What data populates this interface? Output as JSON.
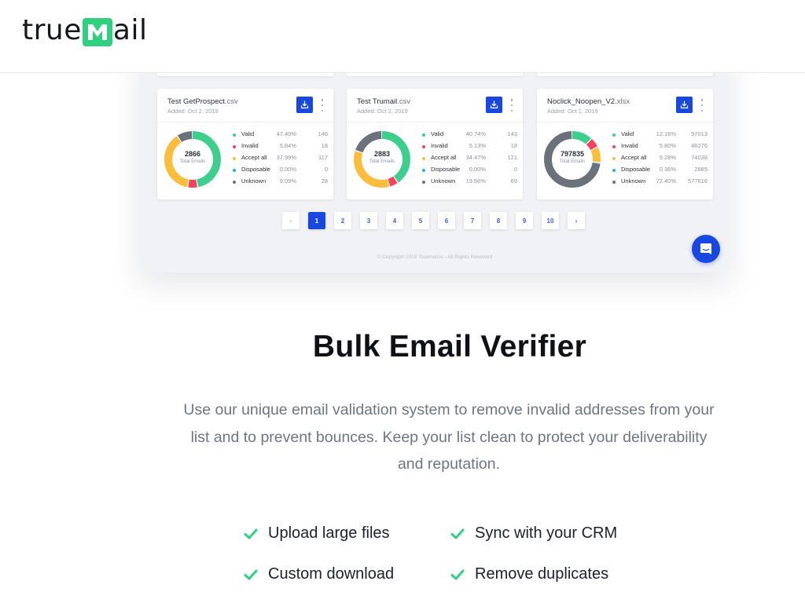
{
  "header": {
    "logo_text_before": "true",
    "logo_text_after": "ail",
    "logo_icon": "envelope-m-icon",
    "brand_color": "#2fd07f"
  },
  "screenshot": {
    "cards": [
      {
        "title_name": "Test GetProspect",
        "title_ext": ".csv",
        "added": "Added: Oct 2, 2019",
        "total": "2866",
        "total_label": "Total Emails",
        "rows": [
          {
            "label": "Valid",
            "pct": "47.40%",
            "count": "146"
          },
          {
            "label": "Invalid",
            "pct": "5.84%",
            "count": "18"
          },
          {
            "label": "Accept all",
            "pct": "37.99%",
            "count": "117"
          },
          {
            "label": "Disposable",
            "pct": "0.00%",
            "count": "0"
          },
          {
            "label": "Unknown",
            "pct": "9.09%",
            "count": "28"
          }
        ],
        "shares": [
          47.4,
          5.84,
          37.99,
          0.0,
          9.09
        ]
      },
      {
        "title_name": "Test Trumail",
        "title_ext": ".csv",
        "added": "Added: Oct 2, 2019",
        "total": "2883",
        "total_label": "Total Emails",
        "rows": [
          {
            "label": "Valid",
            "pct": "40.74%",
            "count": "143"
          },
          {
            "label": "Invalid",
            "pct": "5.13%",
            "count": "18"
          },
          {
            "label": "Accept all",
            "pct": "34.47%",
            "count": "121"
          },
          {
            "label": "Disposable",
            "pct": "0.00%",
            "count": "0"
          },
          {
            "label": "Unknown",
            "pct": "19.66%",
            "count": "69"
          }
        ],
        "shares": [
          40.74,
          5.13,
          34.47,
          0.0,
          19.66
        ]
      },
      {
        "title_name": "Noclick_Noopen_V2",
        "title_ext": ".xlsx",
        "added": "Added: Oct 1, 2019",
        "total": "797835",
        "total_label": "Total Emails",
        "rows": [
          {
            "label": "Valid",
            "pct": "12.16%",
            "count": "97013"
          },
          {
            "label": "Invalid",
            "pct": "5.80%",
            "count": "46276"
          },
          {
            "label": "Accept all",
            "pct": "9.28%",
            "count": "74038"
          },
          {
            "label": "Disposable",
            "pct": "0.36%",
            "count": "2885"
          },
          {
            "label": "Unknown",
            "pct": "72.40%",
            "count": "577616"
          }
        ],
        "shares": [
          12.16,
          5.8,
          9.28,
          0.36,
          72.4
        ]
      }
    ],
    "status_colors": [
      "#3ecf8e",
      "#f5425f",
      "#fbbd3c",
      "#1ab3f0",
      "#6b727c"
    ],
    "pagination": {
      "prev": "‹",
      "pages": [
        "1",
        "2",
        "3",
        "4",
        "5",
        "6",
        "7",
        "8",
        "9",
        "10"
      ],
      "active": "1",
      "next": "›"
    },
    "copyright": "© Copyright 2019 Truemail.io - All Rights Reserved"
  },
  "chat_button": {
    "icon": "chat-bubble-icon"
  },
  "hero": {
    "title": "Bulk Email Verifier",
    "description": "Use our unique email validation system to remove invalid addresses from your list and to prevent bounces. Keep your list clean to protect your deliverability and reputation."
  },
  "features": [
    {
      "label": "Upload large files"
    },
    {
      "label": "Sync with your CRM"
    },
    {
      "label": "Custom download"
    },
    {
      "label": "Remove duplicates"
    }
  ],
  "accent_color": "#1848e0"
}
